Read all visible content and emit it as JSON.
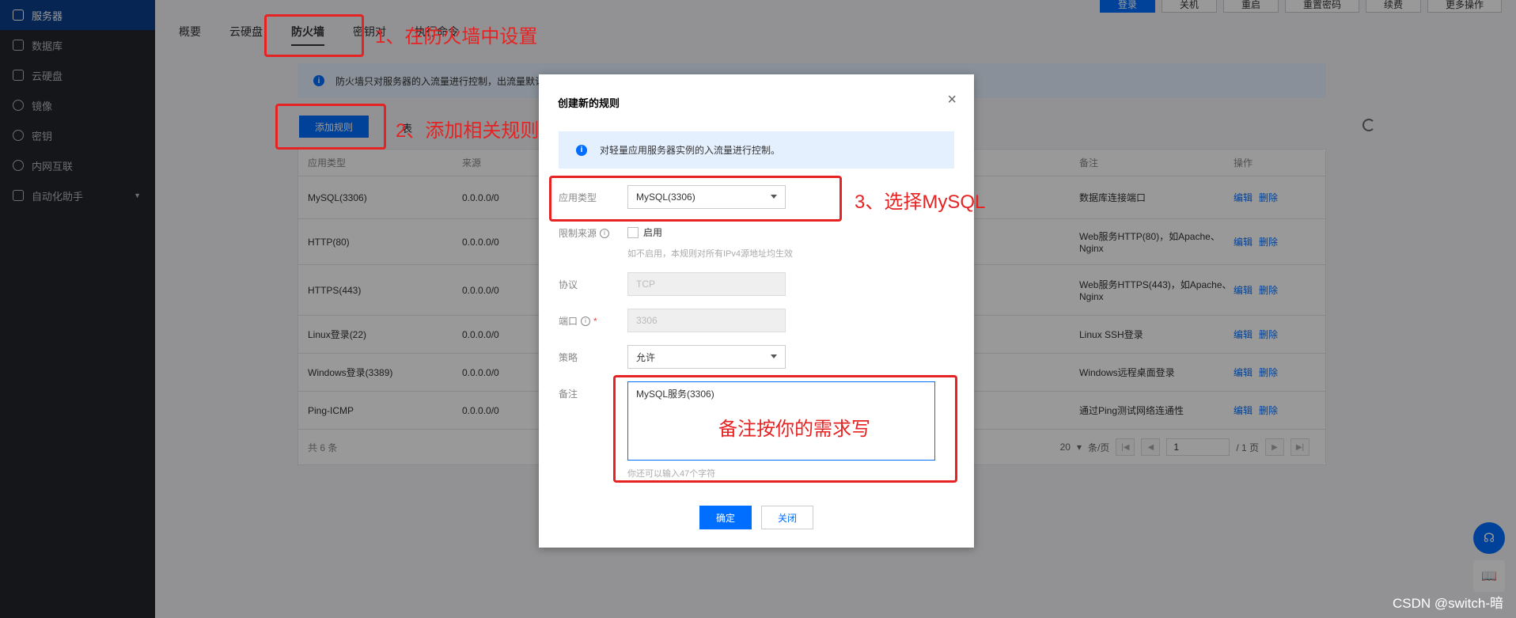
{
  "sidebar": {
    "items": [
      {
        "label": "服务器",
        "icon": "cube-icon"
      },
      {
        "label": "数据库",
        "icon": "database-icon"
      },
      {
        "label": "云硬盘",
        "icon": "disk-icon"
      },
      {
        "label": "镜像",
        "icon": "image-icon"
      },
      {
        "label": "密钥",
        "icon": "key-icon"
      },
      {
        "label": "内网互联",
        "icon": "network-icon"
      },
      {
        "label": "自动化助手",
        "icon": "shield-icon"
      }
    ]
  },
  "topbar": {
    "buttons": [
      "登录",
      "关机",
      "重启",
      "重置密码",
      "续费",
      "更多操作"
    ]
  },
  "tabs": [
    "概要",
    "云硬盘",
    "防火墙",
    "密钥对",
    "执行命令"
  ],
  "firewall": {
    "info": "防火墙只对服务器的入流量进行控制，出流量默认",
    "add_rule_label": "添加规则",
    "table_tools_label": "表",
    "columns": [
      "应用类型",
      "来源",
      "",
      "备注",
      "操作"
    ],
    "rows": [
      {
        "type": "MySQL(3306)",
        "source": "0.0.0.0/0",
        "note": "数据库连接端口",
        "edit": "编辑",
        "delete": "删除"
      },
      {
        "type": "HTTP(80)",
        "source": "0.0.0.0/0",
        "note": "Web服务HTTP(80)，如Apache、Nginx",
        "edit": "编辑",
        "delete": "删除"
      },
      {
        "type": "HTTPS(443)",
        "source": "0.0.0.0/0",
        "note": "Web服务HTTPS(443)，如Apache、Nginx",
        "edit": "编辑",
        "delete": "删除"
      },
      {
        "type": "Linux登录(22)",
        "source": "0.0.0.0/0",
        "note": "Linux SSH登录",
        "edit": "编辑",
        "delete": "删除"
      },
      {
        "type": "Windows登录(3389)",
        "source": "0.0.0.0/0",
        "note": "Windows远程桌面登录",
        "edit": "编辑",
        "delete": "删除"
      },
      {
        "type": "Ping-ICMP",
        "source": "0.0.0.0/0",
        "note": "通过Ping测试网络连通性",
        "edit": "编辑",
        "delete": "删除"
      }
    ],
    "total": "共 6 条",
    "page_size": "20",
    "per_page": "条/页",
    "page": "1",
    "pages": "/ 1 页"
  },
  "modal": {
    "title": "创建新的规则",
    "close": "×",
    "info": "对轻量应用服务器实例的入流量进行控制。",
    "app_type_label": "应用类型",
    "app_type_value": "MySQL(3306)",
    "limit_source_label": "限制来源",
    "enable_label": "启用",
    "limit_hint": "如不启用，本规则对所有IPv4源地址均生效",
    "protocol_label": "协议",
    "protocol_value": "TCP",
    "port_label": "端口",
    "port_required": "*",
    "port_value": "3306",
    "policy_label": "策略",
    "policy_value": "允许",
    "note_label": "备注",
    "note_value": "MySQL服务(3306)",
    "note_hint": "你还可以输入47个字符",
    "ok": "确定",
    "cancel": "关闭"
  },
  "annotations": {
    "step1": "1、在防火墙中设置",
    "step2": "2、添加相关规则",
    "step3": "3、选择MySQL",
    "note_tip": "备注按你的需求写"
  },
  "watermark": "CSDN @switch-暗",
  "colors": {
    "accent": "#006eff",
    "annotation": "#e62222",
    "sidebar": "#22252b"
  }
}
